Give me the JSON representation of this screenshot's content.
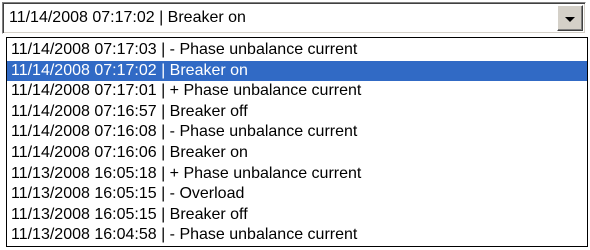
{
  "combo": {
    "value": "11/14/2008  07:17:02 | Breaker on",
    "button_icon": "chevron-down-icon"
  },
  "colors": {
    "selection_bg": "#316ac5",
    "selection_fg": "#ffffff"
  },
  "dropdown": {
    "selected_index": 1,
    "items": [
      "11/14/2008  07:17:03 | - Phase unbalance current",
      "11/14/2008  07:17:02 | Breaker on",
      "11/14/2008  07:17:01 | + Phase unbalance current",
      "11/14/2008  07:16:57 | Breaker off",
      "11/14/2008  07:16:08 | - Phase unbalance current",
      "11/14/2008  07:16:06 | Breaker on",
      "11/13/2008  16:05:18 | + Phase unbalance current",
      "11/13/2008  16:05:15 | - Overload",
      "11/13/2008  16:05:15 | Breaker off",
      "11/13/2008  16:04:58 | - Phase unbalance current"
    ]
  }
}
